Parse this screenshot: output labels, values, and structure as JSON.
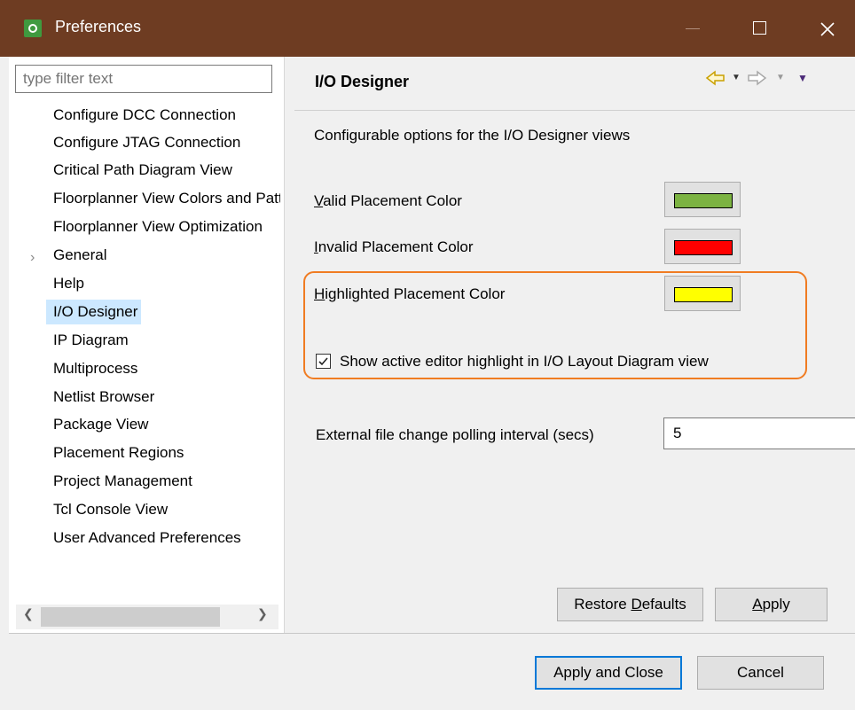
{
  "window": {
    "title": "Preferences"
  },
  "left": {
    "filter_placeholder": "type filter text",
    "tree": [
      "Configure DCC Connection",
      "Configure JTAG Connection",
      "Critical Path Diagram View",
      "Floorplanner View Colors and Patterns",
      "Floorplanner View Optimization",
      "General",
      "Help",
      "I/O Designer",
      "IP Diagram",
      "Multiprocess",
      "Netlist Browser",
      "Package View",
      "Placement Regions",
      "Project Management",
      "Tcl Console View",
      "User Advanced Preferences"
    ],
    "selected_index": 7
  },
  "right": {
    "title": "I/O Designer",
    "description": "Configurable options for the I/O Designer views",
    "valid": {
      "mnemonic": "V",
      "rest": "alid Placement Color",
      "color": "#7cb342"
    },
    "invalid": {
      "mnemonic": "I",
      "rest": "nvalid Placement Color",
      "color": "#ff0000"
    },
    "highlighted": {
      "mnemonic": "H",
      "rest": "ighlighted Placement Color",
      "color": "#ffff00"
    },
    "checkbox_label": "Show active editor highlight in I/O Layout Diagram view",
    "checkbox_checked": true,
    "polling_label": "External file change polling interval (secs)",
    "polling_value": "5",
    "restore_pre": "Restore ",
    "restore_mn": "D",
    "restore_post": "efaults",
    "apply_mn": "A",
    "apply_post": "pply"
  },
  "footer": {
    "apply_close": "Apply and Close",
    "cancel": "Cancel"
  },
  "colors": {
    "titlebar": "#6e3c22",
    "highlight_border": "#f07c22",
    "selection": "#cce8ff"
  }
}
